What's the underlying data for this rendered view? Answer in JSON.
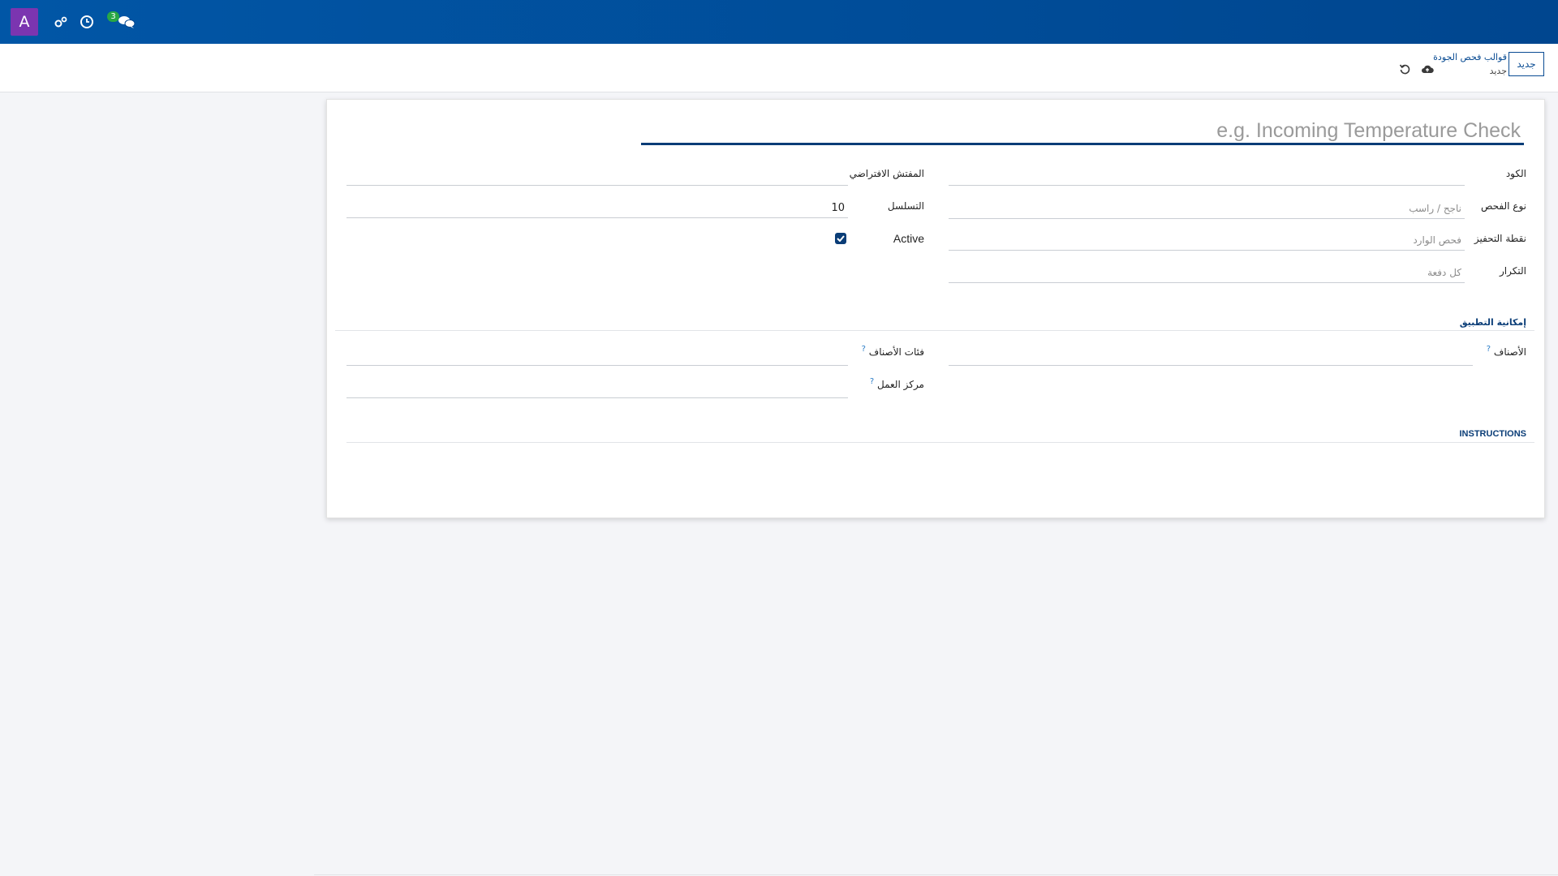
{
  "navbar": {
    "avatar_letter": "A",
    "avatar_color": "#7b35b0",
    "icons": [
      "debug-icon",
      "clock-icon",
      "chat-icon"
    ],
    "messages_count": "3",
    "bg_color": "#0156a6"
  },
  "control": {
    "new_button": "جديد",
    "breadcrumb_parent": "قوالب فحص الجودة",
    "breadcrumb_current": "جديد",
    "icons": [
      "save-cloud-icon",
      "discard-icon"
    ]
  },
  "form": {
    "name_placeholder": "e.g. Incoming Temperature Check",
    "fields": {
      "code_label": "الكود",
      "check_type_label": "نوع الفحص",
      "check_type_placeholder": "ناجح / راسب",
      "trigger_label": "نقطة التحفيز",
      "trigger_placeholder": "فحص الوارد",
      "frequency_label": "التكرار",
      "frequency_placeholder": "كل دفعة",
      "inspector_label": "المفتش الافتراضي",
      "sequence_label": "التسلسل",
      "sequence_value": "10",
      "active_label": "Active",
      "active_checked": true
    },
    "applicability": {
      "section_title": "إمكانية التطبيق",
      "products_label": "الأصناف",
      "categories_label": "فئات الأصناف",
      "workcenter_label": "مركز العمل",
      "help_mark": "?"
    },
    "instructions": {
      "section_title": "INSTRUCTIONS"
    }
  },
  "colors": {
    "accent": "#0a3d77",
    "link": "#0a4c93",
    "badge": "#28a745"
  }
}
